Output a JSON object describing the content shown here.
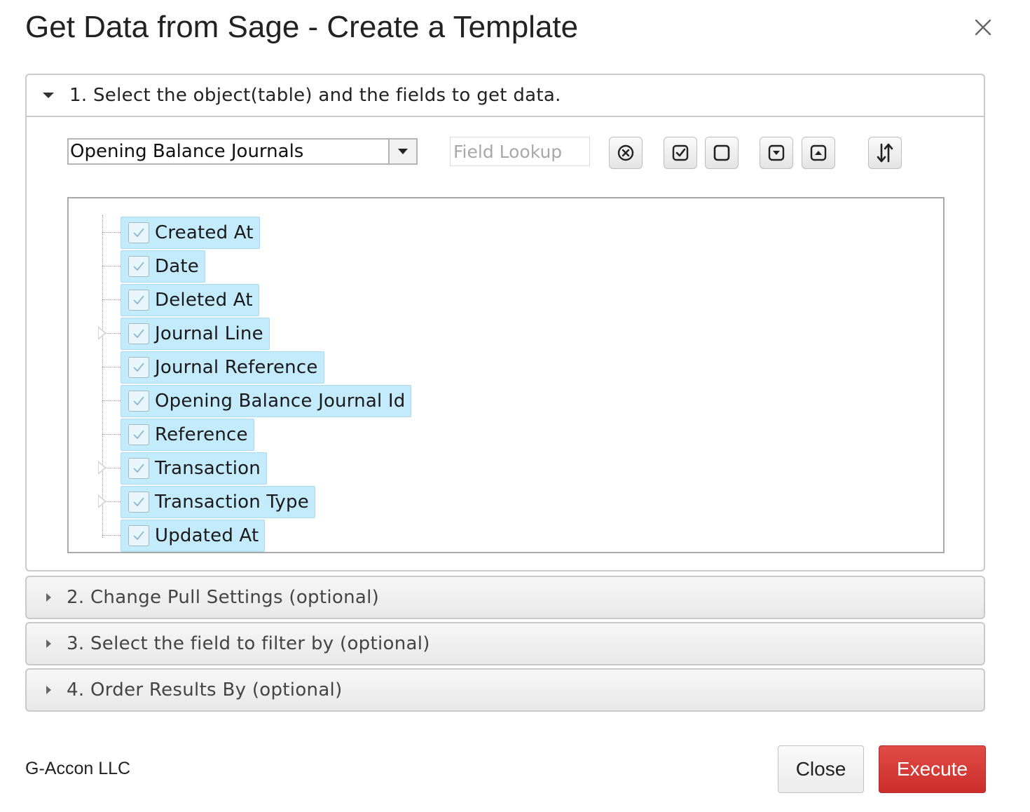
{
  "dialog": {
    "title": "Get Data from Sage - Create a Template",
    "close_icon": "close-icon"
  },
  "sections": [
    {
      "label": "1. Select the object(table) and the fields to get data.",
      "expanded": true
    },
    {
      "label": "2. Change Pull Settings (optional)",
      "expanded": false
    },
    {
      "label": "3. Select the field to filter by (optional)",
      "expanded": false
    },
    {
      "label": "4. Order Results By (optional)",
      "expanded": false
    }
  ],
  "object_select": {
    "value": "Opening Balance Journals"
  },
  "field_lookup": {
    "placeholder": "Field Lookup",
    "value": ""
  },
  "toolbar": {
    "icons": [
      "clear-icon",
      "check-all-icon",
      "uncheck-all-icon",
      "expand-all-icon",
      "collapse-all-icon",
      "sort-icon"
    ]
  },
  "fields": [
    {
      "label": "Created At",
      "checked": true,
      "expandable": false
    },
    {
      "label": "Date",
      "checked": true,
      "expandable": false
    },
    {
      "label": "Deleted At",
      "checked": true,
      "expandable": false
    },
    {
      "label": "Journal Line",
      "checked": true,
      "expandable": true
    },
    {
      "label": "Journal Reference",
      "checked": true,
      "expandable": false
    },
    {
      "label": "Opening Balance Journal Id",
      "checked": true,
      "expandable": false
    },
    {
      "label": "Reference",
      "checked": true,
      "expandable": false
    },
    {
      "label": "Transaction",
      "checked": true,
      "expandable": true
    },
    {
      "label": "Transaction Type",
      "checked": true,
      "expandable": true
    },
    {
      "label": "Updated At",
      "checked": true,
      "expandable": false
    }
  ],
  "footer": {
    "company": "G-Accon LLC",
    "close_label": "Close",
    "execute_label": "Execute"
  },
  "colors": {
    "execute": "#cc2f2b",
    "field_highlight": "#c4ebfb"
  }
}
